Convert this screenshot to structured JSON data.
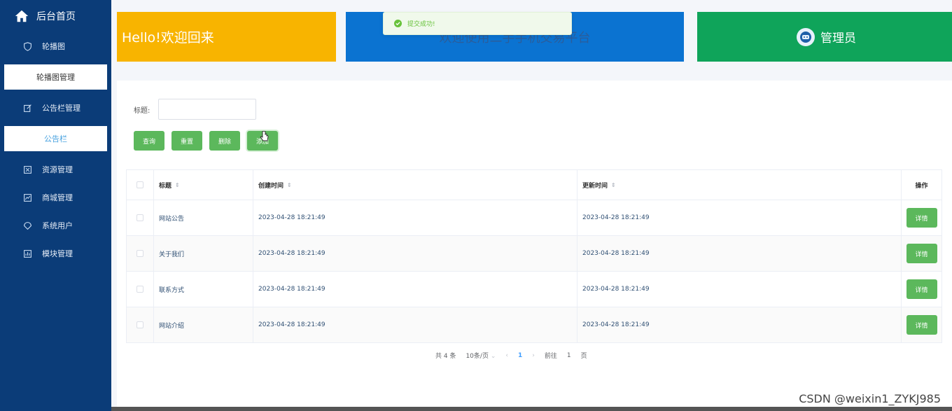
{
  "sidebar": {
    "title": "后台首页",
    "items": [
      {
        "label": "轮播图",
        "icon": "shield-icon"
      },
      {
        "label": "公告栏管理",
        "icon": "edit-icon"
      },
      {
        "label": "资源管理",
        "icon": "resource-icon"
      },
      {
        "label": "商城管理",
        "icon": "chart-icon"
      },
      {
        "label": "系统用户",
        "icon": "user-icon"
      },
      {
        "label": "模块管理",
        "icon": "module-icon"
      }
    ],
    "sub_carousel": "轮播图管理",
    "sub_notice": "公告栏"
  },
  "banners": {
    "welcome": "Hello!欢迎回来",
    "platform": "欢迎使用二手手机交易平台",
    "role": "管理员"
  },
  "toast": {
    "message": "提交成功!"
  },
  "search": {
    "label": "标题:",
    "value": ""
  },
  "buttons": {
    "query": "查询",
    "reset": "重置",
    "delete": "删除",
    "add": "添加"
  },
  "table": {
    "headers": [
      "标题",
      "创建时间",
      "更新时间",
      "操作"
    ],
    "rows": [
      {
        "title": "网站公告",
        "created": "2023-04-28 18:21:49",
        "updated": "2023-04-28 18:21:49",
        "action": "详情"
      },
      {
        "title": "关于我们",
        "created": "2023-04-28 18:21:49",
        "updated": "2023-04-28 18:21:49",
        "action": "详情"
      },
      {
        "title": "联系方式",
        "created": "2023-04-28 18:21:49",
        "updated": "2023-04-28 18:21:49",
        "action": "详情"
      },
      {
        "title": "网站介绍",
        "created": "2023-04-28 18:21:49",
        "updated": "2023-04-28 18:21:49",
        "action": "详情"
      }
    ]
  },
  "pagination": {
    "total": "共 4 条",
    "page_size": "10条/页",
    "current": "1",
    "goto_prefix": "前往",
    "goto_value": "1",
    "goto_suffix": "页"
  },
  "watermark": "CSDN @weixin1_ZYKJ985",
  "colors": {
    "sidebar": "#0b3c78",
    "yellow": "#f8b400",
    "blue": "#0b73d1",
    "green": "#0fa45a",
    "button": "#5cb85c"
  }
}
